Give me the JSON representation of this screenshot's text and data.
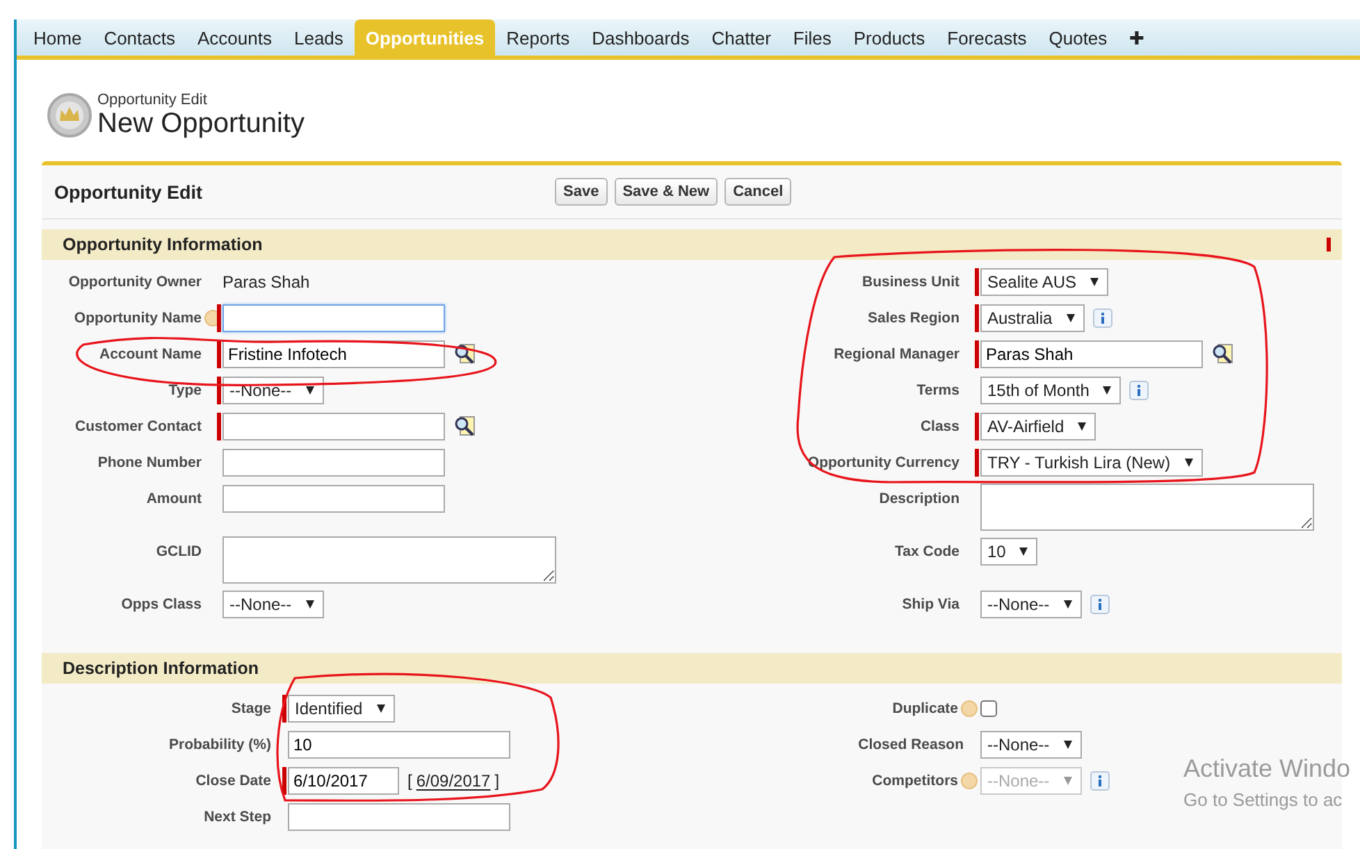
{
  "tabs": [
    {
      "label": "Home",
      "selected": false
    },
    {
      "label": "Contacts",
      "selected": false
    },
    {
      "label": "Accounts",
      "selected": false
    },
    {
      "label": "Leads",
      "selected": false
    },
    {
      "label": "Opportunities",
      "selected": true
    },
    {
      "label": "Reports",
      "selected": false
    },
    {
      "label": "Dashboards",
      "selected": false
    },
    {
      "label": "Chatter",
      "selected": false
    },
    {
      "label": "Files",
      "selected": false
    },
    {
      "label": "Products",
      "selected": false
    },
    {
      "label": "Forecasts",
      "selected": false
    },
    {
      "label": "Quotes",
      "selected": false
    },
    {
      "label": "✚",
      "selected": false
    }
  ],
  "header": {
    "subtitle": "Opportunity Edit",
    "title": "New Opportunity"
  },
  "edit_panel": {
    "title": "Opportunity Edit",
    "buttons": [
      "Save",
      "Save & New",
      "Cancel"
    ]
  },
  "sections": [
    {
      "title": "Opportunity Information",
      "required_legend": true,
      "left": [
        {
          "label": "Opportunity Owner",
          "kind": "text",
          "value": "Paras Shah",
          "required": false,
          "help": false,
          "info": false
        },
        {
          "label": "Opportunity Name",
          "kind": "input",
          "required": true,
          "help": true,
          "info": false,
          "focused": true
        },
        {
          "label": "Account Name",
          "kind": "lookup",
          "value": "Fristine Infotech",
          "required": true,
          "help": false,
          "info": false
        },
        {
          "label": "Type",
          "kind": "select",
          "value": "--None--",
          "required": true,
          "help": false,
          "info": false
        },
        {
          "label": "Customer Contact",
          "kind": "lookup",
          "required": true,
          "help": false,
          "info": false
        },
        {
          "label": "Phone Number",
          "kind": "input",
          "required": false,
          "help": false,
          "info": false
        },
        {
          "label": "Amount",
          "kind": "input",
          "required": false,
          "help": false,
          "info": false
        },
        {
          "label": "GCLID",
          "kind": "textarea",
          "required": false,
          "help": false,
          "info": false
        },
        {
          "label": "Opps Class",
          "kind": "select",
          "value": "--None--",
          "required": false,
          "help": false,
          "info": false
        }
      ],
      "right": [
        {
          "label": "Business Unit",
          "kind": "select",
          "value": "Sealite AUS",
          "required": true,
          "help": false,
          "info": false
        },
        {
          "label": "Sales Region",
          "kind": "select",
          "value": "Australia",
          "required": true,
          "help": false,
          "info": true
        },
        {
          "label": "Regional Manager",
          "kind": "lookup",
          "value": "Paras Shah",
          "required": true,
          "help": false,
          "info": false
        },
        {
          "label": "Terms",
          "kind": "select",
          "value": "15th of Month",
          "required": false,
          "help": false,
          "info": true
        },
        {
          "label": "Class",
          "kind": "select",
          "value": "AV-Airfield",
          "required": true,
          "help": false,
          "info": false
        },
        {
          "label": "Opportunity Currency",
          "kind": "select",
          "value": "TRY - Turkish Lira (New)",
          "required": true,
          "help": false,
          "info": false
        },
        {
          "label": "Description",
          "kind": "textarea",
          "required": false,
          "help": false,
          "info": false
        },
        {
          "label": "Tax Code",
          "kind": "select",
          "value": "10",
          "required": false,
          "help": false,
          "info": false
        },
        {
          "label": "Ship Via",
          "kind": "select",
          "value": "--None--",
          "required": false,
          "help": false,
          "info": true
        }
      ]
    },
    {
      "title": "Description Information",
      "required_legend": false,
      "left": [
        {
          "label": "Stage",
          "kind": "select",
          "value": "Identified",
          "required": true,
          "help": false,
          "info": false
        },
        {
          "label": "Probability (%)",
          "kind": "input",
          "value": "10",
          "required": false,
          "help": false,
          "info": false
        },
        {
          "label": "Close Date",
          "kind": "date",
          "value": "6/10/2017",
          "required": true,
          "help": false,
          "info": false,
          "bracket_open": "[",
          "shortcut": "6/09/2017",
          "bracket_close": "]"
        },
        {
          "label": "Next Step",
          "kind": "input",
          "required": false,
          "help": false,
          "info": false
        }
      ],
      "right": [
        {
          "label": "Duplicate",
          "kind": "checkbox",
          "checked": false,
          "required": false,
          "help": true,
          "info": false
        },
        {
          "label": "Closed Reason",
          "kind": "select",
          "value": "--None--",
          "required": false,
          "help": false,
          "info": false
        },
        {
          "label": "Competitors",
          "kind": "select",
          "value": "--None--",
          "required": false,
          "help": true,
          "info": true,
          "disabled": true
        }
      ]
    }
  ],
  "markups": [
    {
      "kind": "circle"
    },
    {
      "kind": "circle"
    },
    {
      "kind": "circle"
    }
  ],
  "os_watermark": {
    "title": "Activate Windo",
    "subtitle": "Go to Settings to ac"
  }
}
